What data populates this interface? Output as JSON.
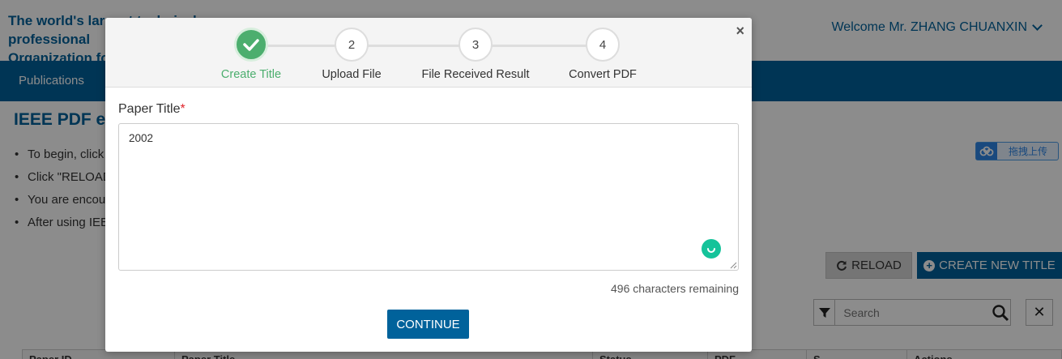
{
  "header": {
    "brand_line1": "The world's largest technical professional",
    "brand_line2": "Organization for the advancement of technology",
    "welcome": "Welcome Mr. ZHANG CHUANXIN"
  },
  "nav": {
    "items": [
      {
        "label": "Publications"
      }
    ]
  },
  "page": {
    "title": "IEEE PDF eXpress",
    "instructions": [
      "To begin, click",
      "Click \"RELOAD",
      "You are encou",
      "After using IEE"
    ]
  },
  "upload_widget": {
    "label": "拖拽上传"
  },
  "toolbar": {
    "reload_label": "RELOAD",
    "create_label": "CREATE NEW TITLE"
  },
  "search": {
    "placeholder": "Search"
  },
  "table": {
    "headers": [
      "Paper ID",
      "Paper Title",
      "Status",
      "PDF",
      "S",
      "Actions"
    ]
  },
  "modal": {
    "steps": [
      {
        "number": "1",
        "label": "Create Title",
        "state": "done"
      },
      {
        "number": "2",
        "label": "Upload File",
        "state": "pending"
      },
      {
        "number": "3",
        "label": "File Received Result",
        "state": "pending"
      },
      {
        "number": "4",
        "label": "Convert PDF",
        "state": "pending"
      }
    ],
    "field_label": "Paper Title",
    "required_mark": "*",
    "field_value": "2002",
    "remaining_text": "496 characters remaining",
    "continue_label": "CONTINUE",
    "close_symbol": "×"
  },
  "colors": {
    "primary": "#00629b",
    "success": "#4cae6e",
    "required": "#e0242b"
  }
}
